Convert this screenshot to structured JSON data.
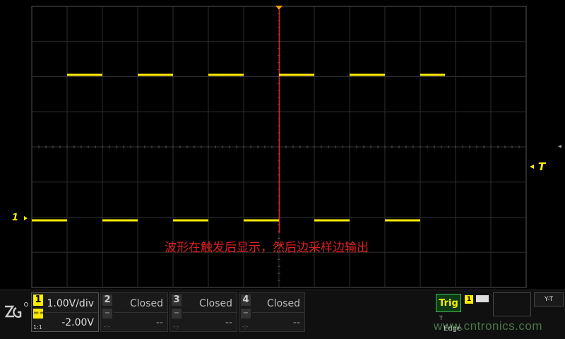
{
  "annotation": "波形在触发后显示，然后边采样边输出",
  "markers": {
    "channel1": "1",
    "trigger_level": "T"
  },
  "waveform": {
    "color": "#ffee00",
    "high_segments": [
      [
        95,
        145
      ],
      [
        195,
        245
      ],
      [
        295,
        345
      ],
      [
        395,
        445
      ],
      [
        495,
        545
      ],
      [
        595,
        630
      ]
    ],
    "low_segments": [
      [
        45,
        95
      ],
      [
        145,
        195
      ],
      [
        245,
        295
      ],
      [
        345,
        395
      ],
      [
        445,
        495
      ],
      [
        545,
        595
      ]
    ]
  },
  "channels": [
    {
      "num": "1",
      "coupling": "==",
      "probe": "1:1",
      "scale": "1.00V/div",
      "offset": "-2.00V",
      "color": "#ffee00",
      "active": true
    },
    {
      "num": "2",
      "coupling": "−",
      "probe": "-:-",
      "scale": "Closed",
      "offset": "--",
      "active": false
    },
    {
      "num": "3",
      "coupling": "−",
      "probe": "-:-",
      "scale": "Closed",
      "offset": "--",
      "active": false
    },
    {
      "num": "4",
      "coupling": "−",
      "probe": "-:-",
      "scale": "Closed",
      "offset": "--",
      "active": false
    }
  ],
  "trigger": {
    "label": "Trig",
    "source": "1",
    "type": "T",
    "mode": "Edge"
  },
  "timebase": {
    "value": ""
  },
  "display_mode": "Y-T",
  "watermark": "www.cntronics.com",
  "colors": {
    "trace": "#ffee00",
    "trigger_line": "#e02020",
    "grid": "#3a3a3a",
    "accent_green": "#3fb950"
  }
}
